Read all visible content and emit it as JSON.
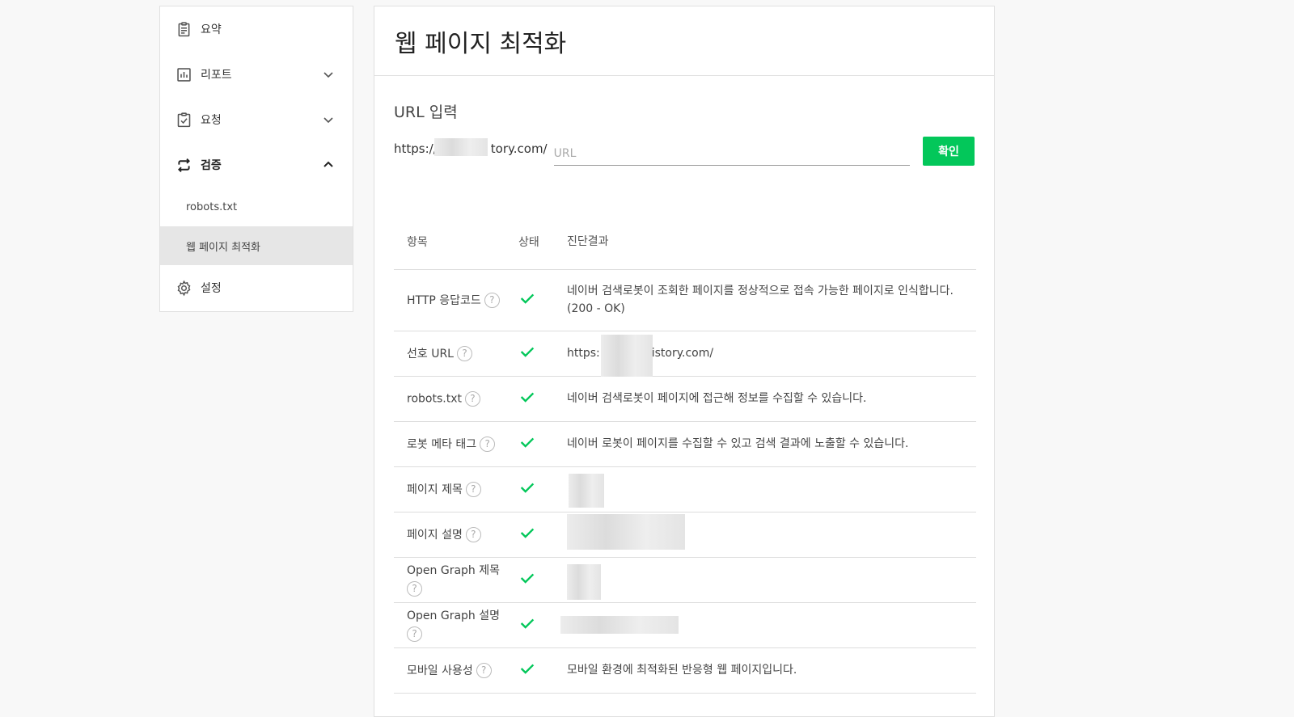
{
  "sidebar": {
    "items": [
      {
        "label": "요약"
      },
      {
        "label": "리포트"
      },
      {
        "label": "요청"
      },
      {
        "label": "검증"
      },
      {
        "label": "설정"
      }
    ],
    "sub_items": [
      {
        "label": "robots.txt"
      },
      {
        "label": "웹 페이지 최적화"
      }
    ]
  },
  "main": {
    "title": "웹 페이지 최적화",
    "url_heading": "URL 입력",
    "url_prefix": "https://",
    "url_prefix_tail": "tory.com/",
    "url_placeholder": "URL",
    "confirm_label": "확인"
  },
  "table": {
    "headers": [
      "항목",
      "상태",
      "진단결과"
    ],
    "rows": [
      {
        "item": "HTTP 응답코드",
        "result": "네이버 검색로봇이 조회한 페이지를 정상적으로 접속 가능한 페이지로 인식합니다.(200 - OK)"
      },
      {
        "item": "선호 URL",
        "result": "https:",
        "result_tail": "istory.com/"
      },
      {
        "item": "robots.txt",
        "result": "네이버 검색로봇이 페이지에 접근해 정보를 수집할 수 있습니다."
      },
      {
        "item": "로봇 메타 태그",
        "result": "네이버 로봇이 페이지를 수집할 수 있고 검색 결과에 노출할 수 있습니다."
      },
      {
        "item": "페이지 제목",
        "result": ""
      },
      {
        "item": "페이지 설명",
        "result": ""
      },
      {
        "item": "Open Graph 제목",
        "result": ""
      },
      {
        "item": "Open Graph 설명",
        "result": ""
      },
      {
        "item": "모바일 사용성",
        "result": "모바일 환경에 최적화된 반응형 웹 페이지입니다."
      }
    ]
  },
  "icons": {
    "help": "?",
    "check_color": "#03c75a",
    "accent": "#03c75a"
  }
}
